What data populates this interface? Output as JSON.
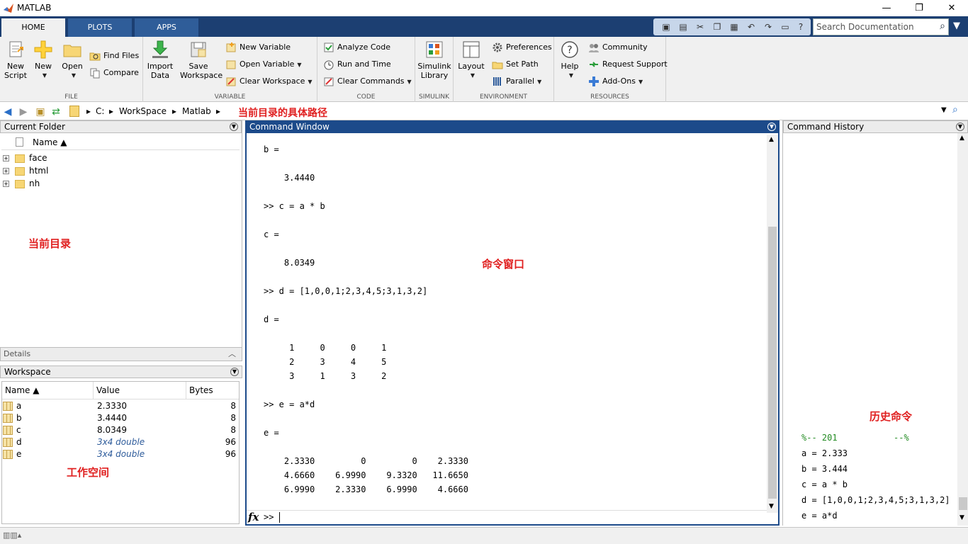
{
  "window": {
    "title": "MATLAB",
    "minimize": "—",
    "restore": "❐",
    "close": "✕"
  },
  "tabs": [
    {
      "label": "HOME"
    },
    {
      "label": "PLOTS"
    },
    {
      "label": "APPS"
    }
  ],
  "search": {
    "placeholder": "Search Documentation"
  },
  "ribbon": {
    "file": {
      "label": "FILE",
      "new_script": "New\nScript",
      "new": "New",
      "open": "Open",
      "find_files": "Find Files",
      "compare": "Compare"
    },
    "variable": {
      "label": "VARIABLE",
      "import_data": "Import\nData",
      "save_workspace": "Save\nWorkspace",
      "new_variable": "New Variable",
      "open_variable": "Open Variable",
      "clear_workspace": "Clear Workspace"
    },
    "code": {
      "label": "CODE",
      "analyze_code": "Analyze Code",
      "run_and_time": "Run and Time",
      "clear_commands": "Clear Commands"
    },
    "simulink": {
      "label": "SIMULINK",
      "library": "Simulink\nLibrary"
    },
    "environment": {
      "label": "ENVIRONMENT",
      "layout": "Layout",
      "preferences": "Preferences",
      "set_path": "Set Path",
      "parallel": "Parallel"
    },
    "resources": {
      "label": "RESOURCES",
      "help": "Help",
      "community": "Community",
      "request_support": "Request Support",
      "add_ons": "Add-Ons"
    }
  },
  "address": {
    "crumbs": [
      "C:",
      "WorkSpace",
      "Matlab"
    ],
    "annotation": "当前目录的具体路径"
  },
  "current_folder": {
    "title": "Current Folder",
    "col_name": "Name ▲",
    "items": [
      "face",
      "html",
      "nh"
    ],
    "annotation": "当前目录"
  },
  "details": {
    "title": "Details"
  },
  "workspace": {
    "title": "Workspace",
    "cols": [
      "Name ▲",
      "Value",
      "Bytes"
    ],
    "rows": [
      {
        "name": "a",
        "value": "2.3330",
        "bytes": "8"
      },
      {
        "name": "b",
        "value": "3.4440",
        "bytes": "8"
      },
      {
        "name": "c",
        "value": "8.0349",
        "bytes": "8"
      },
      {
        "name": "d",
        "value": "3x4 double",
        "bytes": "96"
      },
      {
        "name": "e",
        "value": "3x4 double",
        "bytes": "96"
      }
    ],
    "annotation": "工作空间"
  },
  "command_window": {
    "title": "Command Window",
    "lines": [
      "b =",
      "    3.4440",
      ">> c = a * b",
      "c =",
      "    8.0349",
      ">> d = [1,0,0,1;2,3,4,5;3,1,3,2]",
      "d =",
      "     1     0     0     1",
      "     2     3     4     5",
      "     3     1     3     2",
      ">> e = a*d",
      "e =",
      "    2.3330         0         0    2.3330",
      "    4.6660    6.9990    9.3320   11.6650",
      "    6.9990    2.3330    6.9990    4.6660"
    ],
    "prompt_fx": "fx",
    "prompt": ">>",
    "annotation": "命令窗口"
  },
  "command_history": {
    "title": "Command History",
    "lines": [
      "%-- 201           --%",
      "a = 2.333",
      "b = 3.444",
      "c = a * b",
      "d = [1,0,0,1;2,3,4,5;3,1,3,2]",
      "e = a*d"
    ],
    "annotation": "历史命令"
  },
  "colors": {
    "accent": "#1c4a8a",
    "tabstrip": "#1c3f72",
    "annotation": "#e02020",
    "history_comment": "#228b22"
  }
}
